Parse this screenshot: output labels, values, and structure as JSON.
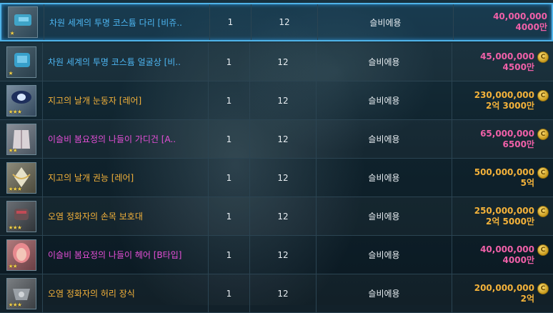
{
  "colors": {
    "name_blue": "#4db6f2",
    "name_orange": "#f4b23a",
    "name_pink": "#e64fd8",
    "price_pink": "#f060a8",
    "price_orange": "#f4b23a",
    "selected_border": "#4fb3e8"
  },
  "rows": [
    {
      "name": "차원 세계의 투명 코스튬 다리 [비쥬..",
      "qty": "1",
      "level": "12",
      "category": "슬비에용",
      "price": "40,000,000",
      "price_short": "4000만",
      "name_color": "blue",
      "price_color": "pink",
      "stars": "★",
      "icon": "costume-legs-icon"
    },
    {
      "name": "차원 세계의 투명 코스튬 얼굴상 [비..",
      "qty": "1",
      "level": "12",
      "category": "슬비에용",
      "price": "45,000,000",
      "price_short": "4500만",
      "name_color": "blue",
      "price_color": "pink",
      "stars": "★",
      "icon": "costume-face-icon"
    },
    {
      "name": "지고의 날개 눈동자 [레어]",
      "qty": "1",
      "level": "12",
      "category": "슬비에용",
      "price": "230,000,000",
      "price_short": "2억 3000만",
      "name_color": "orange",
      "price_color": "orange",
      "stars": "★★★",
      "icon": "wing-eye-icon"
    },
    {
      "name": "이슬비 봄요정의 나들이 가디건 [A..",
      "qty": "1",
      "level": "12",
      "category": "슬비에용",
      "price": "65,000,000",
      "price_short": "6500만",
      "name_color": "pink",
      "price_color": "pink",
      "stars": "★★",
      "icon": "cardigan-icon"
    },
    {
      "name": "지고의 날개 권능 [레어]",
      "qty": "1",
      "level": "12",
      "category": "슬비에용",
      "price": "500,000,000",
      "price_short": "5억",
      "name_color": "orange",
      "price_color": "orange",
      "stars": "★★★",
      "icon": "wing-power-icon"
    },
    {
      "name": "오염 정화자의 손목 보호대",
      "qty": "1",
      "level": "12",
      "category": "슬비에용",
      "price": "250,000,000",
      "price_short": "2억 5000만",
      "name_color": "orange",
      "price_color": "orange",
      "stars": "★★★",
      "icon": "wrist-guard-icon"
    },
    {
      "name": "이슬비 봄요정의 나들이 헤어 [B타입]",
      "qty": "1",
      "level": "12",
      "category": "슬비에용",
      "price": "40,000,000",
      "price_short": "4000만",
      "name_color": "pink",
      "price_color": "pink",
      "stars": "★★",
      "icon": "hair-icon"
    },
    {
      "name": "오염 정화자의 허리 장식",
      "qty": "1",
      "level": "12",
      "category": "슬비에용",
      "price": "200,000,000",
      "price_short": "2억",
      "name_color": "orange",
      "price_color": "orange",
      "stars": "★★★",
      "icon": "waist-ornament-icon"
    }
  ],
  "coin_symbol": "C"
}
